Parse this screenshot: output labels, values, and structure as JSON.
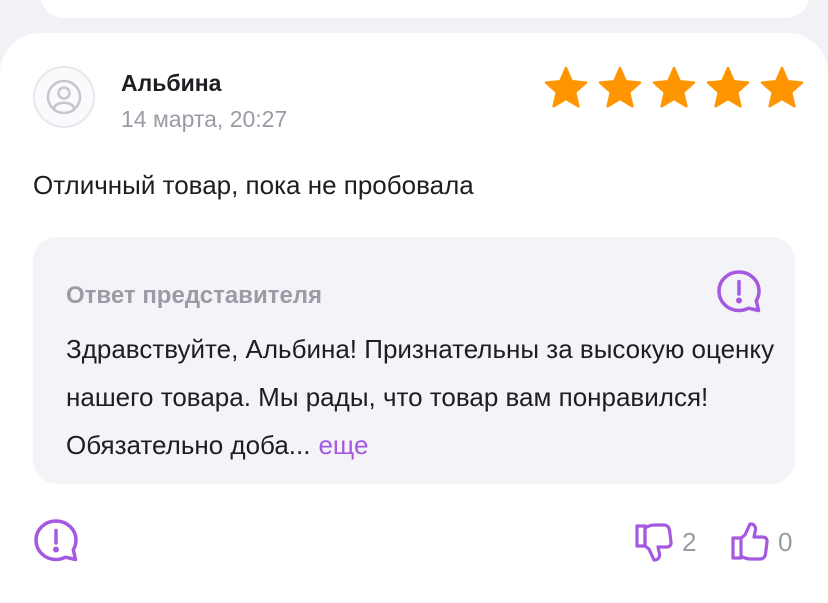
{
  "review": {
    "author": "Альбина",
    "date": "14 марта, 20:27",
    "rating": 5,
    "text": "Отличный товар, пока не пробовала"
  },
  "reply": {
    "title": "Ответ представителя",
    "text": "Здравствуйте, Альбина! Признательны за высокую оценку нашего товара. Мы рады, что товар вам понравился! Обязательно доба...",
    "more_label": "еще"
  },
  "votes": {
    "dislike_count": "2",
    "like_count": "0"
  },
  "colors": {
    "accent": "#a558e0",
    "star": "#ff9500",
    "muted": "#9b9ba6"
  },
  "icons": {
    "avatar": "user-icon",
    "reply": "report-icon",
    "footer": "report-icon",
    "dislike": "thumbs-down-icon",
    "like": "thumbs-up-icon"
  }
}
